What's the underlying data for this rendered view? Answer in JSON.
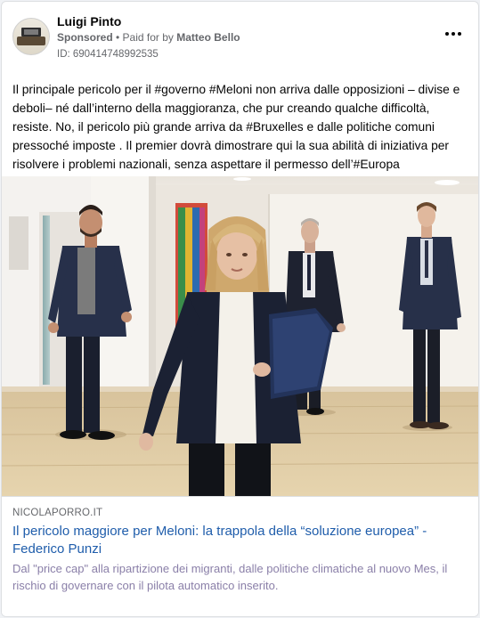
{
  "post": {
    "author": "Luigi Pinto",
    "sponsored_label": "Sponsored",
    "paid_for_label": "• Paid for by",
    "payer": "Matteo Bello",
    "ad_id": "ID: 690414748992535",
    "text": "Il principale pericolo per il #governo #Meloni non arriva dalle opposizioni – divise e deboli– né dall’interno della maggioranza, che pur creando qualche difficoltà, resiste. No, il pericolo più grande arriva da #Bruxelles e dalle politiche comuni pressoché imposte . Il premier dovrà dimostrare qui la sua abilità di iniziativa per risolvere i problemi nazionali, senza aspettare il permesso dell’#Europa",
    "more_icon": "more-options-icon"
  },
  "link": {
    "domain": "NICOLAPORRO.IT",
    "title": "Il pericolo maggiore per Meloni: la trappola della “soluzione europea” - Federico Punzi",
    "description": "Dal \"price cap\" alla ripartizione dei migranti, dalle politiche climatiche al nuovo Mes, il rischio di governare con il pilota automatico inserito."
  },
  "colors": {
    "link_title": "#1f5dab",
    "meta": "#65676b",
    "text": "#050505",
    "description": "#8a7fa8"
  }
}
